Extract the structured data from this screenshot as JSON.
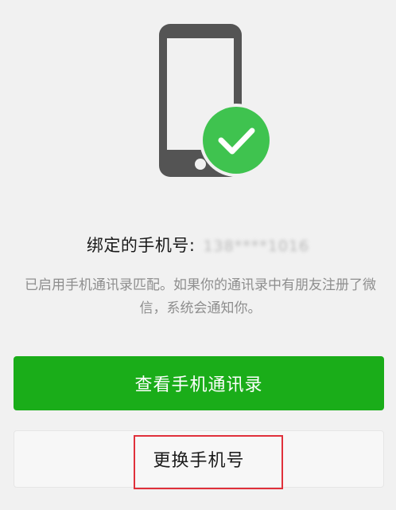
{
  "bound_phone": {
    "label": "绑定的手机号:",
    "number": "138****1016"
  },
  "description": "已启用手机通讯录匹配。如果你的通讯录中有朋友注册了微信，系统会通知你。",
  "buttons": {
    "view_contacts": "查看手机通讯录",
    "change_number": "更换手机号"
  },
  "icons": {
    "phone": "phone-icon",
    "check": "check-badge-icon"
  },
  "colors": {
    "primary_green": "#1aad19",
    "check_green": "#3fc34f",
    "phone_gray": "#545454",
    "highlight_red": "#e0313b"
  }
}
